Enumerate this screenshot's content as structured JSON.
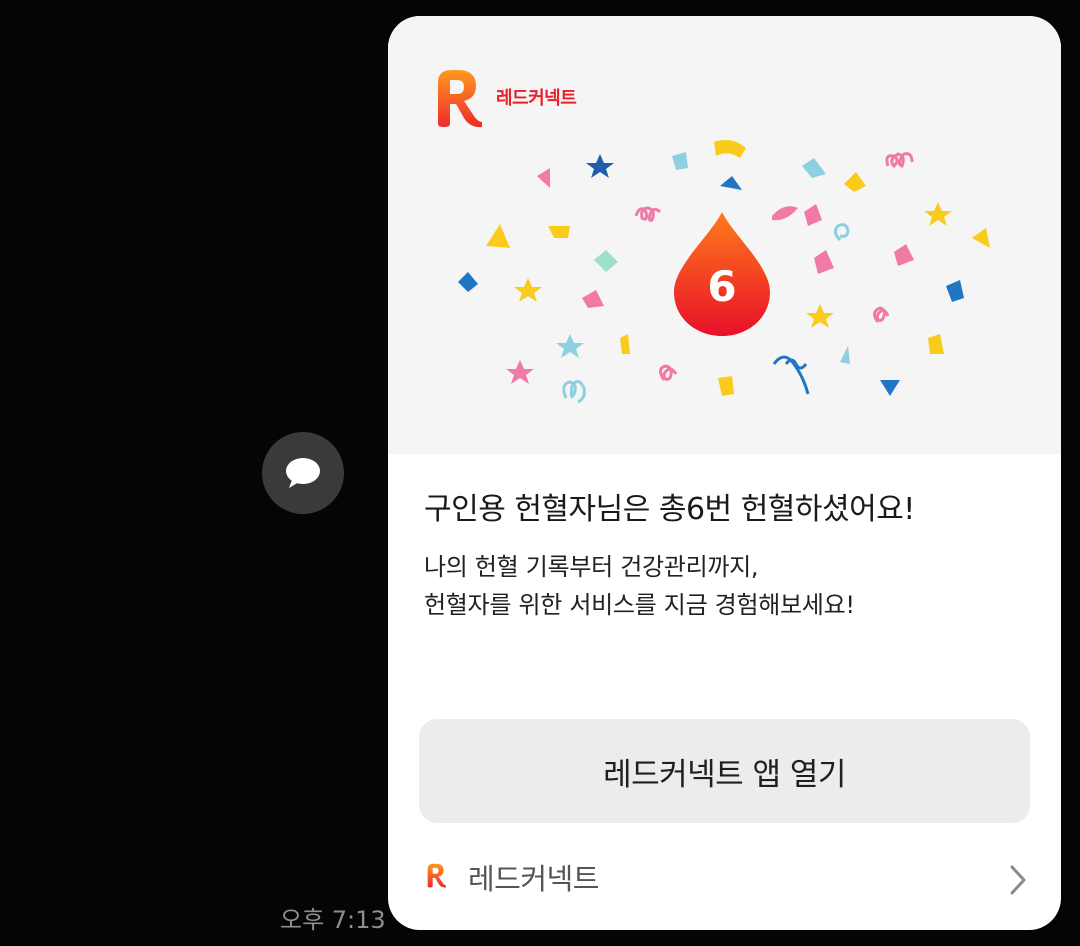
{
  "share_button": {
    "icon": "chat-bubble-icon"
  },
  "message_time": "오후 7:13",
  "card": {
    "brand_name": "레드커넥트",
    "donation_count": "6",
    "headline": "구인용 헌혈자님은 총6번 헌혈하셨어요!",
    "description_line1": "나의 헌혈 기록부터 건강관리까지,",
    "description_line2": "헌혈자를 위한 서비스를 지금 경험해보세요!",
    "open_button_label": "레드커넥트 앱 열기",
    "footer_name": "레드커넥트",
    "colors": {
      "brand_red": "#e8202a",
      "drop_top": "#ff7a1a",
      "drop_bottom": "#e8102a",
      "hero_bg": "#f5f5f5",
      "button_bg": "#ececec"
    }
  }
}
